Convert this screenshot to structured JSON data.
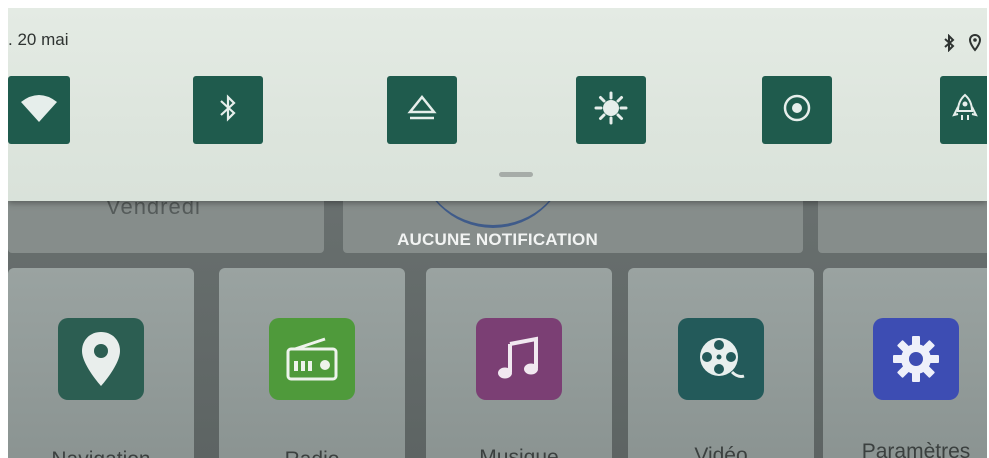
{
  "shade": {
    "date": ". 20 mai",
    "status_icons": [
      "bluetooth-icon",
      "location-icon"
    ],
    "quick_settings": [
      {
        "name": "wifi",
        "icon": "wifi-icon"
      },
      {
        "name": "bluetooth",
        "icon": "bluetooth-icon"
      },
      {
        "name": "eject",
        "icon": "eject-icon"
      },
      {
        "name": "brightness",
        "icon": "brightness-icon"
      },
      {
        "name": "speaker",
        "icon": "speaker-icon"
      },
      {
        "name": "boost",
        "icon": "rocket-icon"
      }
    ],
    "tile_color": "#1f5b4d"
  },
  "notifications": {
    "empty_label": "AUCUNE NOTIFICATION"
  },
  "home": {
    "day": "Vendredi",
    "apps": [
      {
        "label": "Navigation",
        "icon": "map-pin-icon",
        "color": "#2c5e52"
      },
      {
        "label": "Radio",
        "icon": "radio-icon",
        "color": "#4f9a3b"
      },
      {
        "label": "Musique",
        "icon": "music-note-icon",
        "color": "#7b3f74"
      },
      {
        "label": "Vidéo",
        "icon": "film-reel-icon",
        "color": "#235a5a"
      },
      {
        "label": "Paramètres",
        "icon": "gear-icon",
        "color": "#3d4db3"
      }
    ]
  }
}
